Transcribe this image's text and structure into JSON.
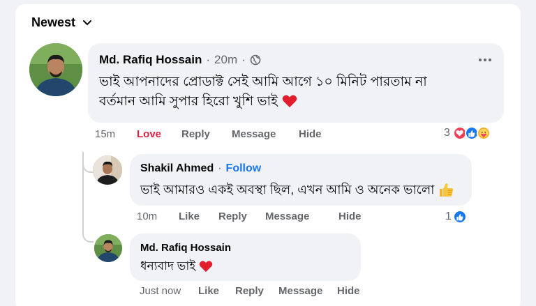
{
  "sort": {
    "label": "Newest"
  },
  "comments": [
    {
      "author": "Md. Rafiq Hossain",
      "age": "20m",
      "text_line1": "ভাই আপনাদের প্রোডাক্ট সেই আমি আগে ১০ মিনিট পারতাম না",
      "text_line2": "বর্তমান আমি সুপার হিরো খুশি ভাই",
      "actions": {
        "time": "15m",
        "love": "Love",
        "reply": "Reply",
        "message": "Message",
        "hide": "Hide"
      },
      "reactions": {
        "count": "3"
      },
      "replies": [
        {
          "author": "Shakil Ahmed",
          "follow": "Follow",
          "text": "ভাই আমারও একই অবস্থা ছিল, এখন আমি ও অনেক ভালো",
          "actions": {
            "time": "10m",
            "like": "Like",
            "reply": "Reply",
            "message": "Message",
            "hide": "Hide"
          },
          "reactions": {
            "count": "1"
          }
        },
        {
          "author": "Md. Rafiq Hossain",
          "text": "ধন্যবাদ ভাই",
          "actions": {
            "time": "Just now",
            "like": "Like",
            "reply": "Reply",
            "message": "Message",
            "hide": "Hide"
          }
        }
      ]
    }
  ],
  "colors": {
    "accent": "#1877f2",
    "love": "#e41e3f",
    "bubble": "#f0f2f5",
    "muted": "#65676b"
  },
  "icons": [
    "chevron-down-icon",
    "globe-icon",
    "more-options-icon",
    "heart-emoji-icon",
    "thumbs-up-emoji-icon",
    "love-reaction-icon",
    "like-reaction-icon",
    "care-reaction-icon"
  ]
}
